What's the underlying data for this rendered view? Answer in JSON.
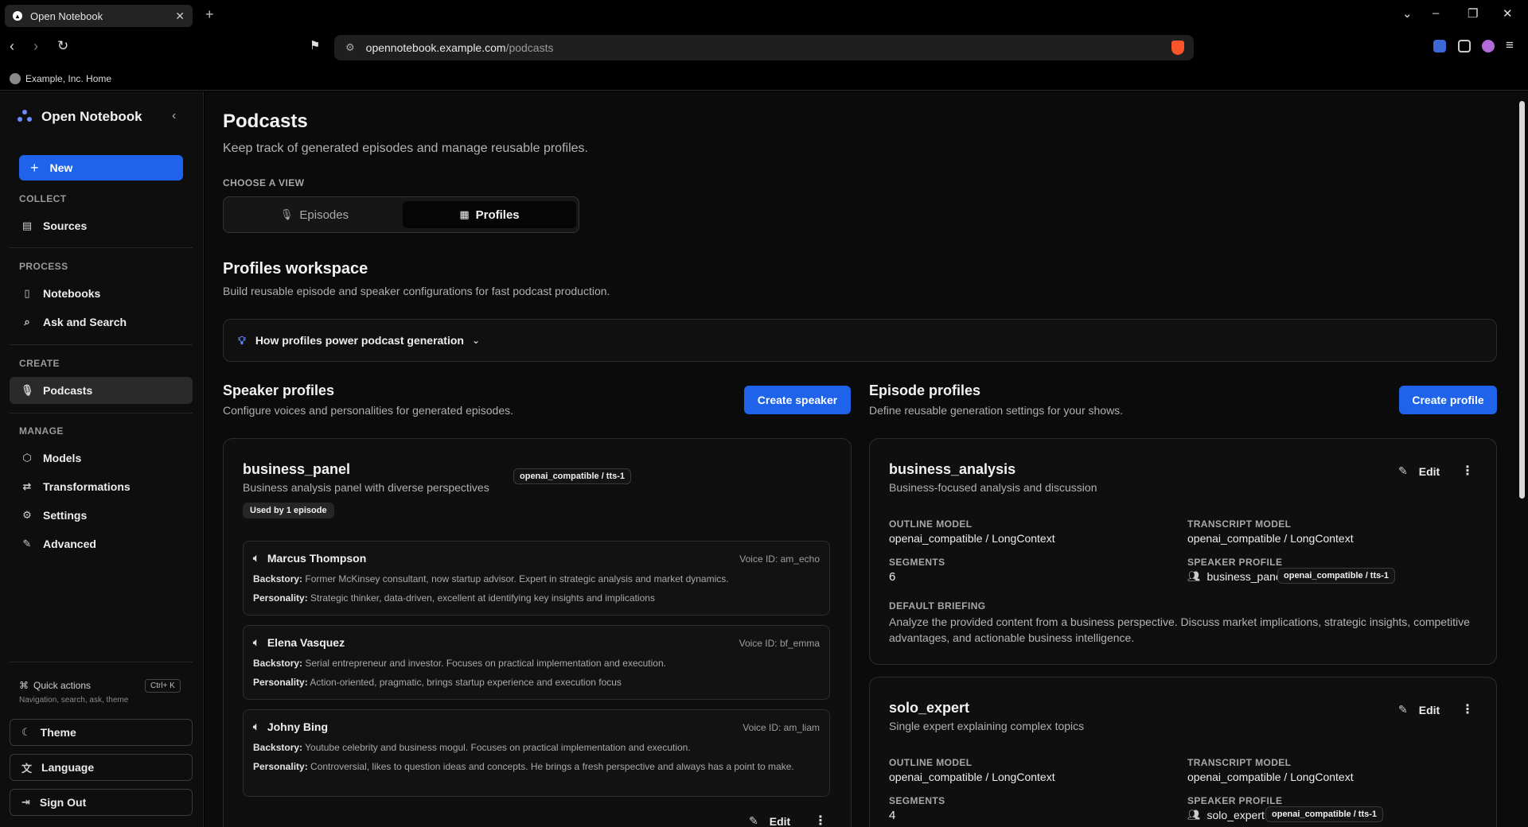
{
  "browser": {
    "tab_title": "Open Notebook",
    "tab_favicon": "notebook-logo-icon",
    "url_host": "opennotebook.example.com",
    "url_path": "/podcasts",
    "bookmark": "Example, Inc. Home"
  },
  "sidebar": {
    "brand": "Open Notebook",
    "new_label": "New",
    "sections": {
      "collect": "COLLECT",
      "process": "PROCESS",
      "create": "CREATE",
      "manage": "MANAGE"
    },
    "items": {
      "sources": "Sources",
      "notebooks": "Notebooks",
      "ask": "Ask and Search",
      "podcasts": "Podcasts",
      "models": "Models",
      "transformations": "Transformations",
      "settings": "Settings",
      "advanced": "Advanced"
    },
    "quick_actions": "Quick actions",
    "quick_shortcut": "Ctrl+ K",
    "quick_sub": "Navigation, search, ask, theme",
    "theme": "Theme",
    "language": "Language",
    "sign_out": "Sign Out"
  },
  "page": {
    "title": "Podcasts",
    "subtitle": "Keep track of generated episodes and manage reusable profiles.",
    "view_label": "CHOOSE A VIEW",
    "tab_episodes": "Episodes",
    "tab_profiles": "Profiles",
    "workspace_title": "Profiles workspace",
    "workspace_sub": "Build reusable episode and speaker configurations for fast podcast production.",
    "howto": "How profiles power podcast generation"
  },
  "speakers": {
    "title": "Speaker profiles",
    "sub": "Configure voices and personalities for generated episodes.",
    "create": "Create speaker",
    "card": {
      "name": "business_panel",
      "desc": "Business analysis panel with diverse perspectives",
      "model": "openai_compatible / tts-1",
      "used": "Used by 1 episode",
      "edit": "Edit",
      "people": [
        {
          "name": "Marcus Thompson",
          "voice": "Voice ID: am_echo",
          "backstory_label": "Backstory:",
          "backstory": "Former McKinsey consultant, now startup advisor. Expert in strategic analysis and market dynamics.",
          "personality_label": "Personality:",
          "personality": "Strategic thinker, data-driven, excellent at identifying key insights and implications"
        },
        {
          "name": "Elena Vasquez",
          "voice": "Voice ID: bf_emma",
          "backstory_label": "Backstory:",
          "backstory": "Serial entrepreneur and investor. Focuses on practical implementation and execution.",
          "personality_label": "Personality:",
          "personality": "Action-oriented, pragmatic, brings startup experience and execution focus"
        },
        {
          "name": "Johny Bing",
          "voice": "Voice ID: am_liam",
          "backstory_label": "Backstory:",
          "backstory": "Youtube celebrity and business mogul. Focuses on practical implementation and execution.",
          "personality_label": "Personality:",
          "personality": "Controversial, likes to question ideas and concepts. He brings a fresh perspective and always has a point to make."
        }
      ]
    }
  },
  "episodes": {
    "title": "Episode profiles",
    "sub": "Define reusable generation settings for your shows.",
    "create": "Create profile",
    "labels": {
      "outline": "OUTLINE MODEL",
      "transcript": "TRANSCRIPT MODEL",
      "segments": "SEGMENTS",
      "speaker_profile": "SPEAKER PROFILE",
      "briefing": "DEFAULT BRIEFING",
      "edit": "Edit"
    },
    "cards": [
      {
        "name": "business_analysis",
        "desc": "Business-focused analysis and discussion",
        "outline": "openai_compatible / LongContext",
        "transcript": "openai_compatible / LongContext",
        "segments": "6",
        "speaker": "business_panel",
        "speaker_model": "openai_compatible / tts-1",
        "briefing": "Analyze the provided content from a business perspective. Discuss market implications, strategic insights, competitive advantages, and actionable business intelligence."
      },
      {
        "name": "solo_expert",
        "desc": "Single expert explaining complex topics",
        "outline": "openai_compatible / LongContext",
        "transcript": "openai_compatible / LongContext",
        "segments": "4",
        "speaker": "solo_expert",
        "speaker_model": "openai_compatible / tts-1"
      }
    ]
  }
}
